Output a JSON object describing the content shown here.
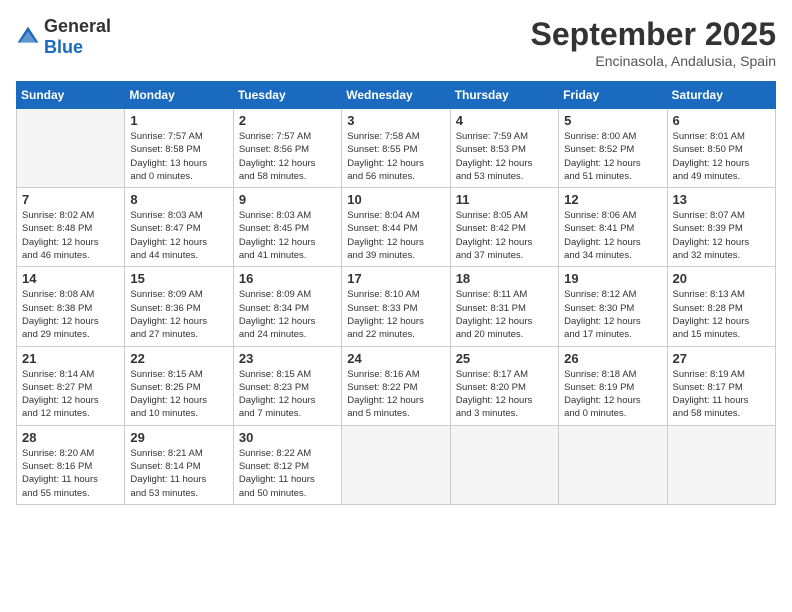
{
  "logo": {
    "general": "General",
    "blue": "Blue"
  },
  "title": "September 2025",
  "location": "Encinasola, Andalusia, Spain",
  "weekdays": [
    "Sunday",
    "Monday",
    "Tuesday",
    "Wednesday",
    "Thursday",
    "Friday",
    "Saturday"
  ],
  "weeks": [
    [
      {
        "day": "",
        "info": ""
      },
      {
        "day": "1",
        "info": "Sunrise: 7:57 AM\nSunset: 8:58 PM\nDaylight: 13 hours\nand 0 minutes."
      },
      {
        "day": "2",
        "info": "Sunrise: 7:57 AM\nSunset: 8:56 PM\nDaylight: 12 hours\nand 58 minutes."
      },
      {
        "day": "3",
        "info": "Sunrise: 7:58 AM\nSunset: 8:55 PM\nDaylight: 12 hours\nand 56 minutes."
      },
      {
        "day": "4",
        "info": "Sunrise: 7:59 AM\nSunset: 8:53 PM\nDaylight: 12 hours\nand 53 minutes."
      },
      {
        "day": "5",
        "info": "Sunrise: 8:00 AM\nSunset: 8:52 PM\nDaylight: 12 hours\nand 51 minutes."
      },
      {
        "day": "6",
        "info": "Sunrise: 8:01 AM\nSunset: 8:50 PM\nDaylight: 12 hours\nand 49 minutes."
      }
    ],
    [
      {
        "day": "7",
        "info": "Sunrise: 8:02 AM\nSunset: 8:48 PM\nDaylight: 12 hours\nand 46 minutes."
      },
      {
        "day": "8",
        "info": "Sunrise: 8:03 AM\nSunset: 8:47 PM\nDaylight: 12 hours\nand 44 minutes."
      },
      {
        "day": "9",
        "info": "Sunrise: 8:03 AM\nSunset: 8:45 PM\nDaylight: 12 hours\nand 41 minutes."
      },
      {
        "day": "10",
        "info": "Sunrise: 8:04 AM\nSunset: 8:44 PM\nDaylight: 12 hours\nand 39 minutes."
      },
      {
        "day": "11",
        "info": "Sunrise: 8:05 AM\nSunset: 8:42 PM\nDaylight: 12 hours\nand 37 minutes."
      },
      {
        "day": "12",
        "info": "Sunrise: 8:06 AM\nSunset: 8:41 PM\nDaylight: 12 hours\nand 34 minutes."
      },
      {
        "day": "13",
        "info": "Sunrise: 8:07 AM\nSunset: 8:39 PM\nDaylight: 12 hours\nand 32 minutes."
      }
    ],
    [
      {
        "day": "14",
        "info": "Sunrise: 8:08 AM\nSunset: 8:38 PM\nDaylight: 12 hours\nand 29 minutes."
      },
      {
        "day": "15",
        "info": "Sunrise: 8:09 AM\nSunset: 8:36 PM\nDaylight: 12 hours\nand 27 minutes."
      },
      {
        "day": "16",
        "info": "Sunrise: 8:09 AM\nSunset: 8:34 PM\nDaylight: 12 hours\nand 24 minutes."
      },
      {
        "day": "17",
        "info": "Sunrise: 8:10 AM\nSunset: 8:33 PM\nDaylight: 12 hours\nand 22 minutes."
      },
      {
        "day": "18",
        "info": "Sunrise: 8:11 AM\nSunset: 8:31 PM\nDaylight: 12 hours\nand 20 minutes."
      },
      {
        "day": "19",
        "info": "Sunrise: 8:12 AM\nSunset: 8:30 PM\nDaylight: 12 hours\nand 17 minutes."
      },
      {
        "day": "20",
        "info": "Sunrise: 8:13 AM\nSunset: 8:28 PM\nDaylight: 12 hours\nand 15 minutes."
      }
    ],
    [
      {
        "day": "21",
        "info": "Sunrise: 8:14 AM\nSunset: 8:27 PM\nDaylight: 12 hours\nand 12 minutes."
      },
      {
        "day": "22",
        "info": "Sunrise: 8:15 AM\nSunset: 8:25 PM\nDaylight: 12 hours\nand 10 minutes."
      },
      {
        "day": "23",
        "info": "Sunrise: 8:15 AM\nSunset: 8:23 PM\nDaylight: 12 hours\nand 7 minutes."
      },
      {
        "day": "24",
        "info": "Sunrise: 8:16 AM\nSunset: 8:22 PM\nDaylight: 12 hours\nand 5 minutes."
      },
      {
        "day": "25",
        "info": "Sunrise: 8:17 AM\nSunset: 8:20 PM\nDaylight: 12 hours\nand 3 minutes."
      },
      {
        "day": "26",
        "info": "Sunrise: 8:18 AM\nSunset: 8:19 PM\nDaylight: 12 hours\nand 0 minutes."
      },
      {
        "day": "27",
        "info": "Sunrise: 8:19 AM\nSunset: 8:17 PM\nDaylight: 11 hours\nand 58 minutes."
      }
    ],
    [
      {
        "day": "28",
        "info": "Sunrise: 8:20 AM\nSunset: 8:16 PM\nDaylight: 11 hours\nand 55 minutes."
      },
      {
        "day": "29",
        "info": "Sunrise: 8:21 AM\nSunset: 8:14 PM\nDaylight: 11 hours\nand 53 minutes."
      },
      {
        "day": "30",
        "info": "Sunrise: 8:22 AM\nSunset: 8:12 PM\nDaylight: 11 hours\nand 50 minutes."
      },
      {
        "day": "",
        "info": ""
      },
      {
        "day": "",
        "info": ""
      },
      {
        "day": "",
        "info": ""
      },
      {
        "day": "",
        "info": ""
      }
    ]
  ]
}
